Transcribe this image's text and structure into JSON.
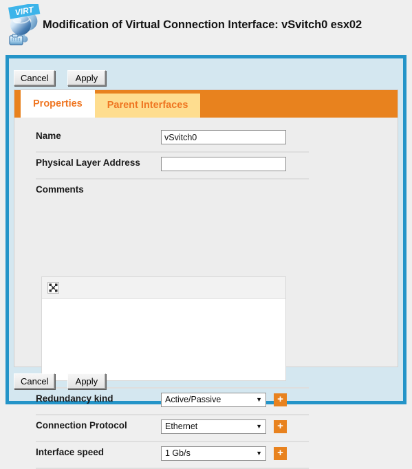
{
  "header": {
    "logo_icon": "virt-network-cable-icon",
    "logo_badge": "VIRT",
    "title": "Modification of Virtual Connection Interface: vSvitch0 esx02"
  },
  "toolbar_top": {
    "cancel_label": "Cancel",
    "apply_label": "Apply"
  },
  "toolbar_bottom": {
    "cancel_label": "Cancel",
    "apply_label": "Apply"
  },
  "tabs": [
    {
      "label": "Properties",
      "active": true
    },
    {
      "label": "Parent Interfaces",
      "active": false
    }
  ],
  "form": {
    "name": {
      "label": "Name",
      "value": "vSvitch0",
      "placeholder": ""
    },
    "physical_layer_address": {
      "label": "Physical Layer Address",
      "value": "",
      "placeholder": ""
    },
    "comments": {
      "label": "Comments",
      "toolbar_icon": "broken-image-icon",
      "value": ""
    },
    "redundancy_kind": {
      "label": "Redundancy kind",
      "value": "Active/Passive",
      "add_label": "+"
    },
    "connection_protocol": {
      "label": "Connection Protocol",
      "value": "Ethernet",
      "add_label": "+"
    },
    "interface_speed": {
      "label": "Interface speed",
      "value": "1 Gb/s",
      "add_label": "+"
    }
  },
  "colors": {
    "accent_orange": "#e8821e",
    "tab_inactive": "#fedd8f",
    "frame_blue": "#2494c8",
    "frame_fill": "#d4e7f0",
    "panel_gray": "#ededed"
  }
}
